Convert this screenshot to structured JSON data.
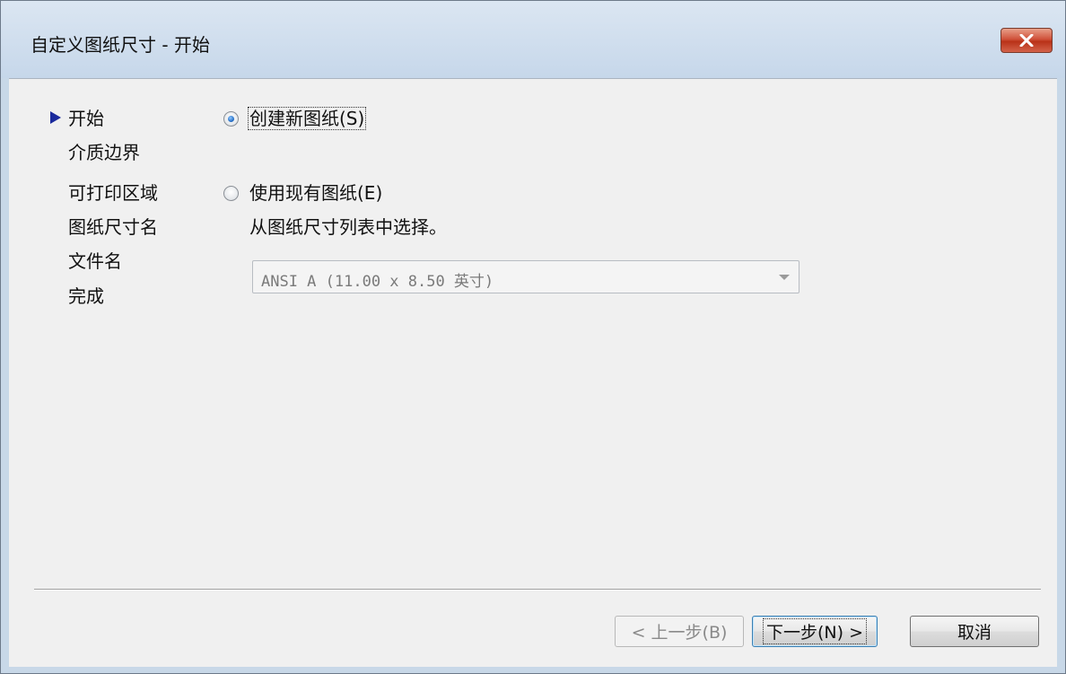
{
  "window": {
    "title": "自定义图纸尺寸 - 开始",
    "close_icon": "close-icon"
  },
  "nav": {
    "items": [
      {
        "label": "开始",
        "current": true
      },
      {
        "label": "介质边界",
        "current": false
      },
      {
        "label": "可打印区域",
        "current": false
      },
      {
        "label": "图纸尺寸名",
        "current": false
      },
      {
        "label": "文件名",
        "current": false
      },
      {
        "label": "完成",
        "current": false
      }
    ]
  },
  "options": {
    "create_new": {
      "label": "创建新图纸(S)",
      "selected": true
    },
    "use_existing": {
      "label": "使用现有图纸(E)",
      "selected": false
    },
    "hint": "从图纸尺寸列表中选择。",
    "paper_size_select": {
      "value": "ANSI A (11.00 x 8.50 英寸)",
      "enabled": false
    }
  },
  "buttons": {
    "back": "< 上一步(B)",
    "next": "下一步(N) >",
    "cancel": "取消"
  },
  "colors": {
    "titlebar": "#c6d7ea",
    "client": "#f0f0f0",
    "close_button": "#c94a30",
    "nav_arrow": "#1a2a9c"
  }
}
